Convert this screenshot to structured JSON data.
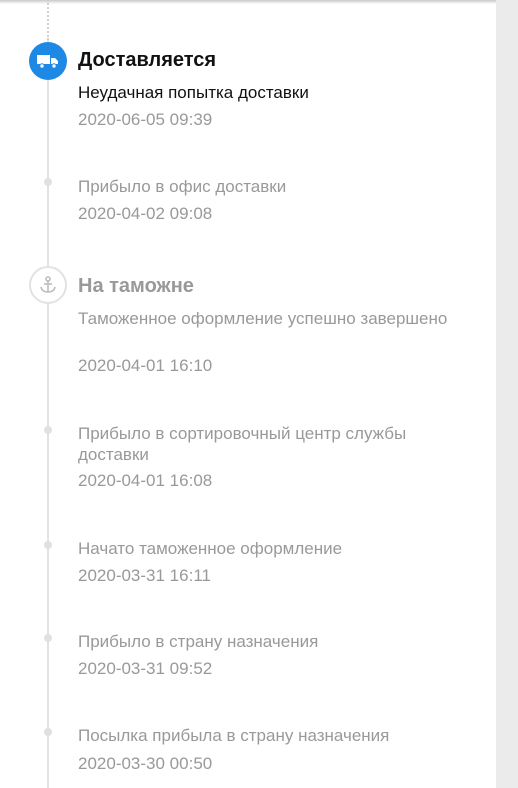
{
  "colors": {
    "accent": "#1e88e5",
    "title_active": "#111111",
    "muted_text": "#999999",
    "timeline_line": "#e3e3e3"
  },
  "timeline": {
    "groups": [
      {
        "status": "Доставляется",
        "icon": "truck-icon",
        "active": true,
        "events": [
          {
            "text": "Неудачная попытка доставки",
            "time": "2020-06-05 09:39"
          },
          {
            "text": "Прибыло в офис доставки",
            "time": "2020-04-02 09:08"
          }
        ]
      },
      {
        "status": "На таможне",
        "icon": "anchor-icon",
        "active": false,
        "events": [
          {
            "text": "Таможенное оформление успешно завершено",
            "time": "2020-04-01 16:10"
          },
          {
            "text": "Прибыло в сортировочный центр службы доставки",
            "time": "2020-04-01 16:08"
          },
          {
            "text": "Начато таможенное оформление",
            "time": "2020-03-31 16:11"
          },
          {
            "text": "Прибыло в страну назначения",
            "time": "2020-03-31 09:52"
          },
          {
            "text": "Посылка прибыла в страну назначения",
            "time": "2020-03-30 00:50"
          }
        ]
      }
    ]
  }
}
